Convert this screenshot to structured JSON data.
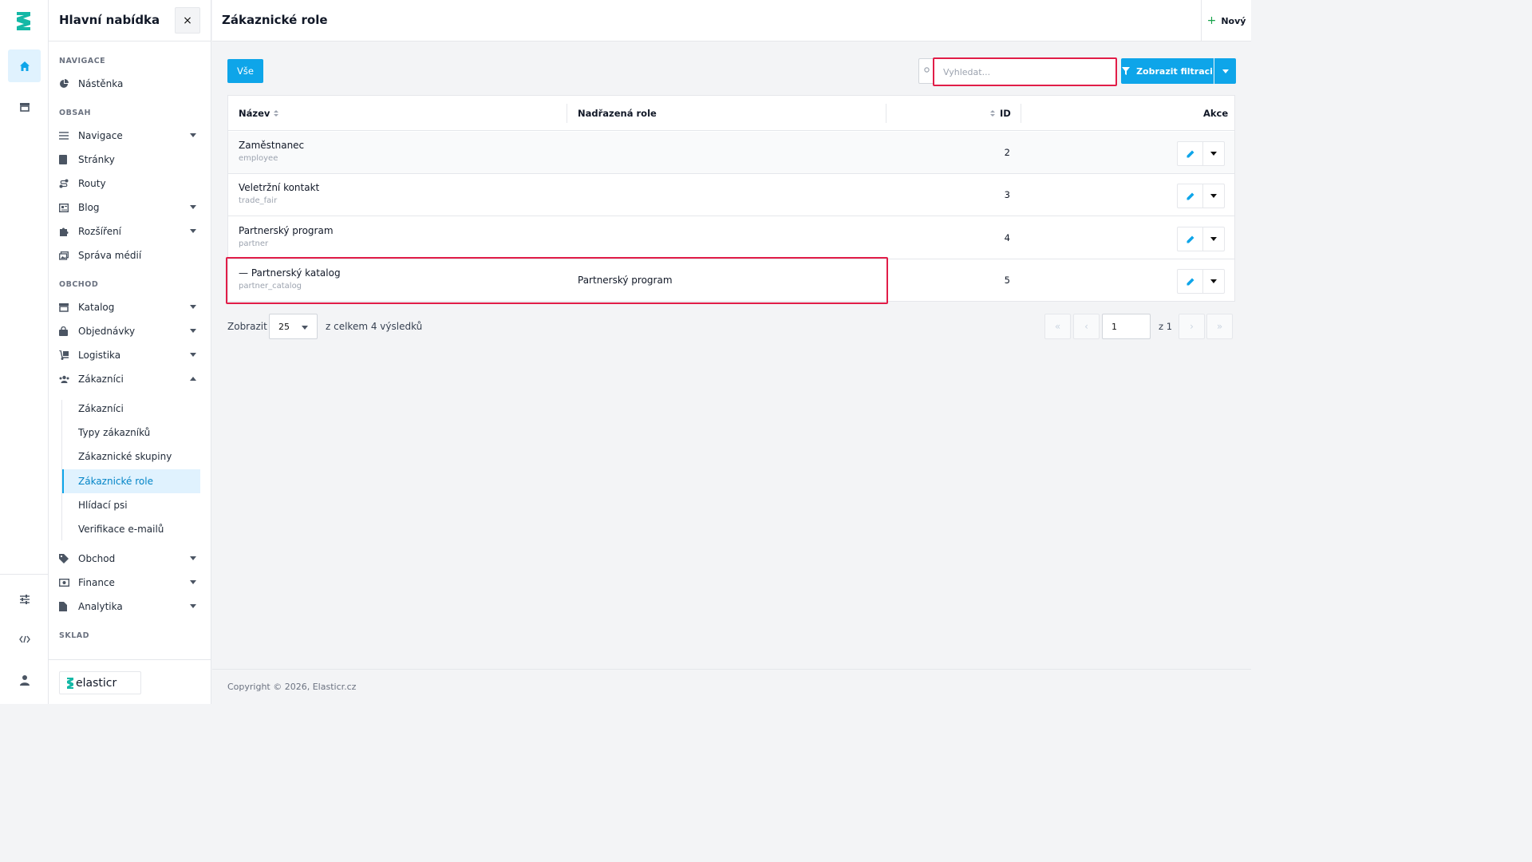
{
  "sidebar": {
    "title": "Hlavní nabídka",
    "close_label": "×",
    "sections": {
      "navigation": "NAVIGACE",
      "content": "OBSAH",
      "shop": "OBCHOD",
      "warehouse": "SKLAD"
    },
    "items": {
      "dashboard": "Nástěnka",
      "navigation": "Navigace",
      "pages": "Stránky",
      "routes": "Routy",
      "blog": "Blog",
      "extensions": "Rozšíření",
      "media": "Správa médií",
      "catalog": "Katalog",
      "orders": "Objednávky",
      "logistics": "Logistika",
      "customers": "Zákazníci",
      "commerce": "Obchod",
      "finance": "Finance",
      "analytics": "Analytika"
    },
    "customers_sub": {
      "customers": "Zákazníci",
      "types": "Typy zákazníků",
      "groups": "Zákaznické skupiny",
      "roles": "Zákaznické role",
      "watchdogs": "Hlídací psi",
      "email_verification": "Verifikace e-mailů"
    },
    "brand": "elasticr"
  },
  "header": {
    "title": "Zákaznické role",
    "new_label": "Nový"
  },
  "toolbar": {
    "all_label": "Vše",
    "search_placeholder": "Vyhledat...",
    "filter_label": "Zobrazit filtraci"
  },
  "table": {
    "columns": {
      "name": "Název",
      "parent": "Nadřazená role",
      "id": "ID",
      "actions": "Akce"
    },
    "rows": [
      {
        "name": "Zaměstnanec",
        "code": "employee",
        "parent": "",
        "id": "2"
      },
      {
        "name": "Veletržní kontakt",
        "code": "trade_fair",
        "parent": "",
        "id": "3"
      },
      {
        "name": "Partnerský program",
        "code": "partner",
        "parent": "",
        "id": "4"
      },
      {
        "name": "— Partnerský katalog",
        "code": "partner_catalog",
        "parent": "Partnerský program",
        "id": "5"
      }
    ]
  },
  "pagination": {
    "show_label": "Zobrazit",
    "per_page": "25",
    "total_text": "z celkem 4 výsledků",
    "current_page": "1",
    "of_text": "z 1",
    "first": "«",
    "prev": "‹",
    "next": "›",
    "last": "»"
  },
  "footer": {
    "copyright": "Copyright © 2026, Elasticr.cz"
  },
  "colors": {
    "accent": "#0ea5e9",
    "highlight": "#e11d48",
    "active_bg": "#e0f2fe"
  }
}
